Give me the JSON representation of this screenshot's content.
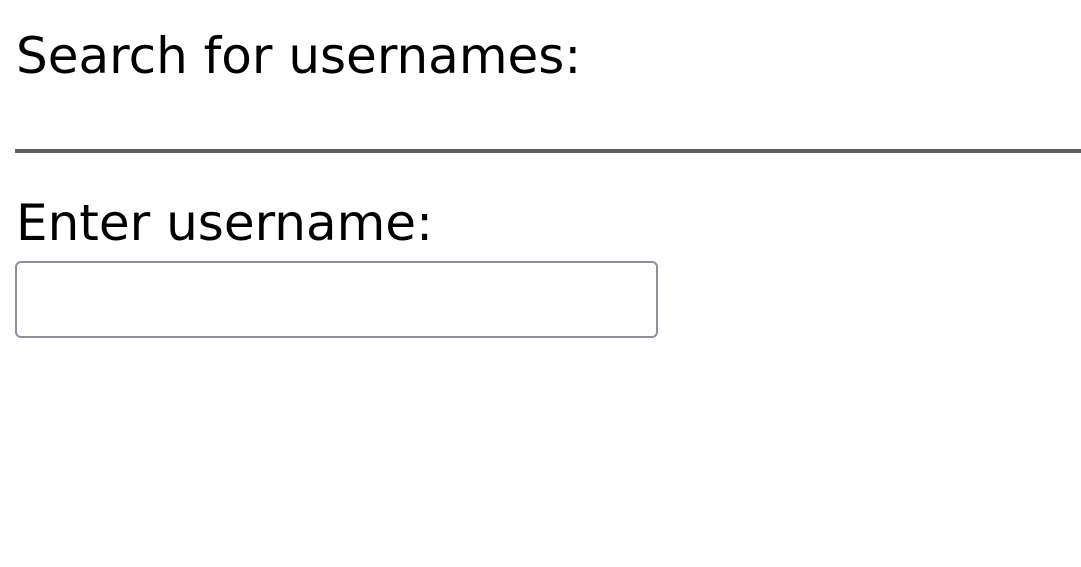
{
  "header": {
    "title": "Search for usernames:"
  },
  "form": {
    "username_label": "Enter username:",
    "username_value": "",
    "username_placeholder": ""
  }
}
